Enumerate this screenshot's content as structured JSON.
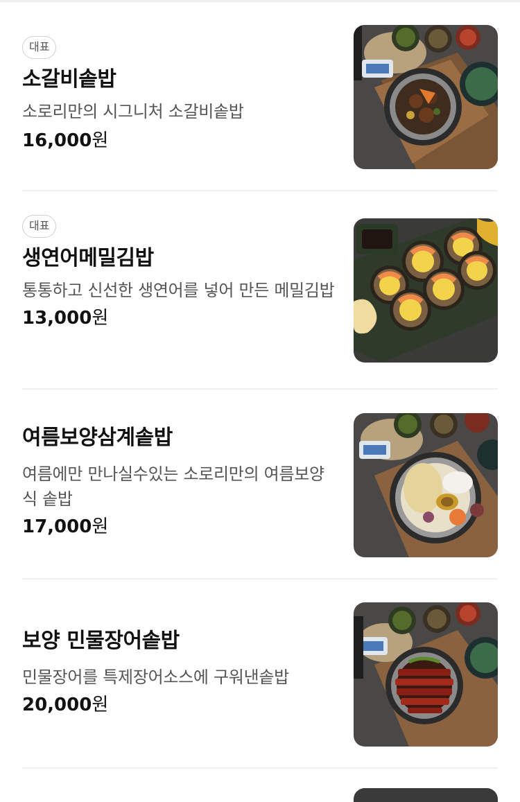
{
  "menu": {
    "items": [
      {
        "badge": "대표",
        "name": "소갈비솥밥",
        "description": "소로리만의 시그니처 소갈비솥밥",
        "price": "16,000",
        "currency": "원",
        "image": "beef-rib-pot-rice-photo"
      },
      {
        "badge": "대표",
        "name": "생연어메밀김밥",
        "description": "통통하고 신선한 생연어를 넣어 만든 메밀김밥",
        "price": "13,000",
        "currency": "원",
        "image": "salmon-kimbap-photo"
      },
      {
        "badge": "",
        "name": "여름보양삼계솥밥",
        "description": "여름에만 만나실수있는 소로리만의 여름보양식 솥밥",
        "price": "17,000",
        "currency": "원",
        "image": "samgye-pot-rice-photo"
      },
      {
        "badge": "",
        "name": "보양 민물장어솥밥",
        "description": "민물장어를 특제장어소스에 구워낸솥밥",
        "price": "20,000",
        "currency": "원",
        "image": "eel-pot-rice-photo"
      }
    ]
  }
}
